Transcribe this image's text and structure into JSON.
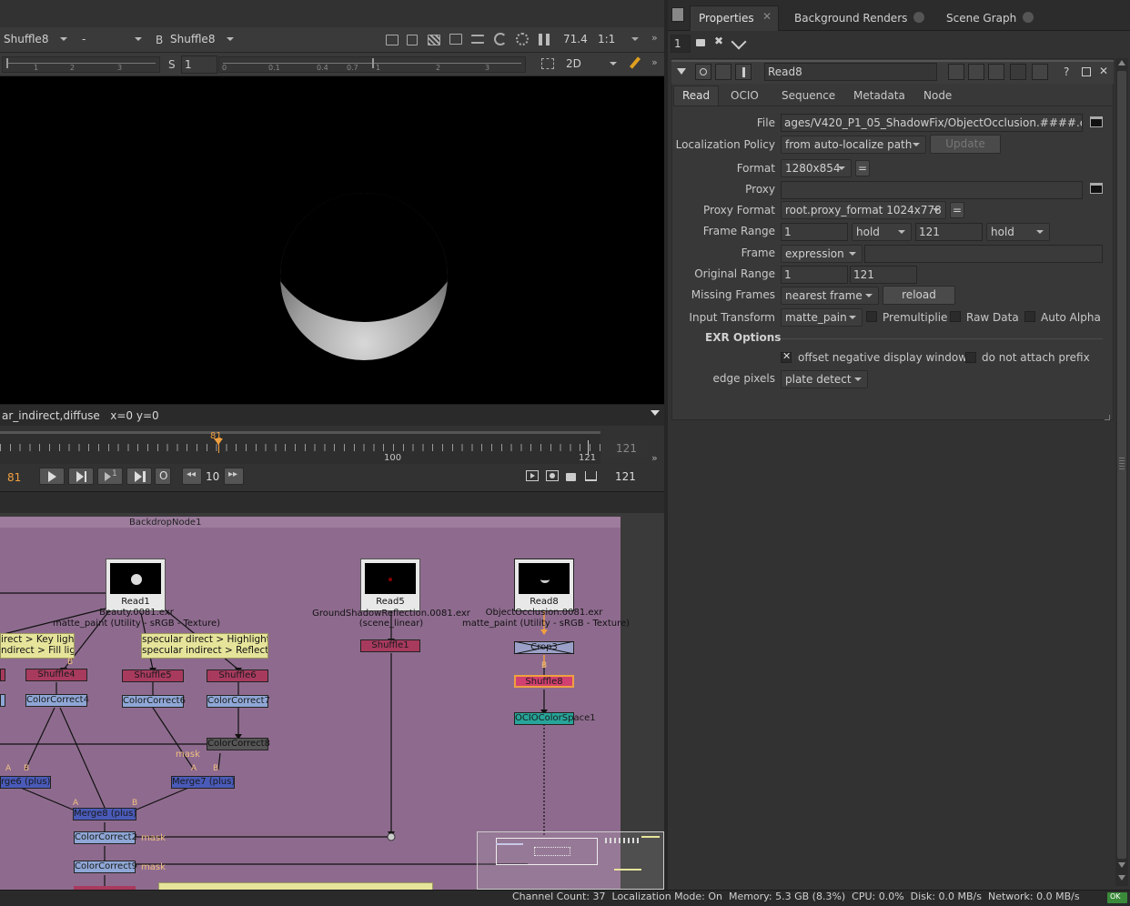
{
  "viewer": {
    "input_a": "Shuffle8",
    "channel": "-",
    "b_label": "B",
    "input_b": "Shuffle8",
    "zoom": "71.4",
    "ratio": "1:1",
    "s_label": "S",
    "s_value": "1",
    "mode": "2D",
    "status_text": "ar_indirect,diffuse   x=0 y=0",
    "gain_ticks": [
      "1",
      "2",
      "3"
    ],
    "gamma_ticks": [
      "0",
      "0.1",
      "0.4",
      "0.7",
      "1",
      "2",
      "3"
    ]
  },
  "timeline": {
    "current_frame": "81",
    "tick_100": "100",
    "tick_121": "121",
    "end_frame_top": "121",
    "end_frame": "121",
    "frame_field": "81",
    "step": "10",
    "o_label": "O"
  },
  "dag": {
    "backdrop_label": "BackdropNode1",
    "nodes": {
      "read1": "Read1",
      "read1_file": "Beauty.0081.exr",
      "read1_cs": "matte_paint (Utility - sRGB - Texture)",
      "read5": "Read5",
      "read5_file": "GroundShadowReflection.0081.exr",
      "read5_cs": "(scene_linear)",
      "read8": "Read8",
      "read8_file": "ObjectOcclusion.0081.exr",
      "read8_cs": "matte_paint (Utility - sRGB - Texture)",
      "shuffle1": "Shuffle1",
      "shuffle4": "Shuffle4",
      "shuffle5": "Shuffle5",
      "shuffle6": "Shuffle6",
      "shuffle8": "Shuffle8",
      "crop": "Crop3",
      "cc4": "ColorCorrect4",
      "cc6": "ColorCorrect6",
      "cc7": "ColorCorrect7",
      "cc8": "ColorCorrect8",
      "cc2": "ColorCorrect2",
      "cc9": "ColorCorrect9",
      "merge6": "rge6 (plus)",
      "merge7": "Merge7 (plus)",
      "merge8": "Merge8 (plus)",
      "ocio": "OCIOColorSpace1",
      "mask1": "mask",
      "mask2": "mask",
      "mask3": "mask",
      "a1": "A",
      "b1": "B",
      "a2": "A",
      "b2": "B",
      "a3": "A",
      "b3": "B",
      "b4": "B",
      "b5": "B"
    },
    "stickies": {
      "left_line1": "irect > Key light",
      "left_line2": "ndirect > Fill ligh",
      "right_line1": "specular direct > Highlight",
      "right_line2": "specular indirect > Reflection"
    }
  },
  "panel": {
    "tabs": [
      "Properties",
      "Background Renders",
      "Scene Graph"
    ],
    "max_panels": "1",
    "node_name": "Read8",
    "subtabs": [
      "Read",
      "OCIO",
      "Sequence",
      "Metadata",
      "Node"
    ],
    "labels": {
      "file": "File",
      "localization": "Localization Policy",
      "format": "Format",
      "proxy": "Proxy",
      "proxy_format": "Proxy Format",
      "frame_range": "Frame Range",
      "frame": "Frame",
      "original_range": "Original Range",
      "missing_frames": "Missing Frames",
      "input_transform": "Input Transform",
      "exr_options": "EXR Options",
      "edge_pixels": "edge pixels"
    },
    "values": {
      "file": "ages/V420_P1_05_ShadowFix/ObjectOcclusion.####.exr",
      "localization": "from auto-localize path",
      "update": "Update",
      "format": "1280x854",
      "eq1": "=",
      "proxy": "",
      "proxy_format": "root.proxy_format 1024x778",
      "eq2": "=",
      "frame_start": "1",
      "before": "hold",
      "frame_end": "121",
      "after": "hold",
      "frame_mode": "expression",
      "frame_expr": "",
      "orig_start": "1",
      "orig_end": "121",
      "missing": "nearest frame",
      "reload": "reload",
      "input_transform": "matte_pain",
      "premultiplied": "Premultipliec",
      "raw_data": "Raw Data",
      "auto_alpha": "Auto Alpha",
      "offset_neg": "offset negative display window",
      "no_prefix": "do not attach prefix",
      "edge_pixels": "plate detect"
    }
  },
  "status_bar": "Channel Count: 37  Localization Mode: On  Memory: 5.3 GB (8.3%)  CPU: 0.0%  Disk: 0.0 MB/s  Network: 0.0 MB/s",
  "status_ok": "OK",
  "colors": {
    "backdrop": "#8e6b8e",
    "shuffle": "#a83a5e",
    "colorcorrect": "#8fa7d6",
    "merge": "#4a5ab8",
    "ocio": "#27a59a",
    "crop": "#9aa0c8",
    "accent": "#f0a040"
  }
}
